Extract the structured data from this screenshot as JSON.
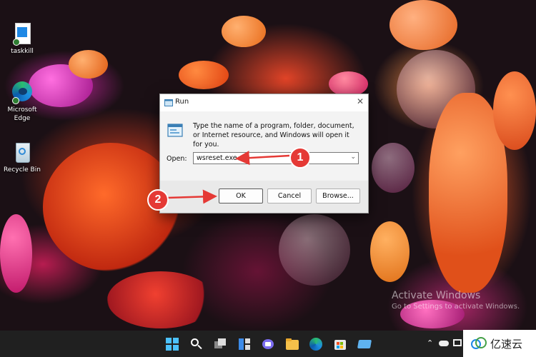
{
  "desktop": {
    "icons": [
      {
        "label": "taskkill"
      },
      {
        "label": "Microsoft Edge"
      },
      {
        "label": "Recycle Bin"
      }
    ]
  },
  "run_dialog": {
    "title": "Run",
    "description": "Type the name of a program, folder, document, or Internet resource, and Windows will open it for you.",
    "open_label": "Open:",
    "open_value": "wsreset.exe",
    "ok_label": "OK",
    "cancel_label": "Cancel",
    "browse_label": "Browse..."
  },
  "annotations": {
    "step1": "1",
    "step2": "2",
    "color": "#e53935"
  },
  "watermark": {
    "line1": "Activate Windows",
    "line2": "Go to Settings to activate Windows."
  },
  "taskbar": {
    "icons": [
      "start-icon",
      "search-icon",
      "task-view-icon",
      "widgets-icon",
      "chat-icon",
      "file-explorer-icon",
      "edge-icon",
      "store-icon",
      "pinned-app-icon"
    ],
    "tray_icons": [
      "chevron-up-icon",
      "cloud-icon",
      "display-icon"
    ]
  },
  "logo": {
    "text": "亿速云"
  }
}
